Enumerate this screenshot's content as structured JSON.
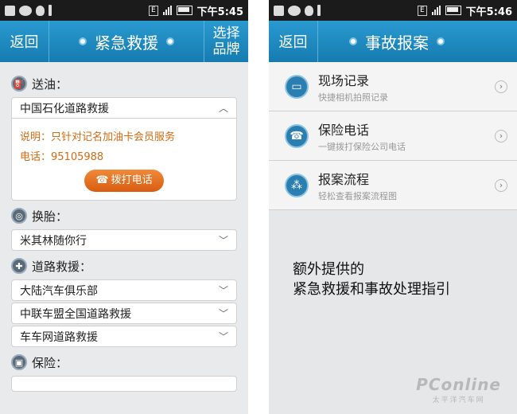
{
  "status_bar": {
    "left_time": "下午5:45",
    "right_time": "下午5:46",
    "network_badge": "E"
  },
  "left": {
    "nav": {
      "back": "返回",
      "title": "紧急救援",
      "right_line1": "选择",
      "right_line2": "品牌"
    },
    "fuel": {
      "label": "送油：",
      "icon": "fuel-icon",
      "provider": "中国石化道路救援",
      "note": "说明：只针对记名加油卡会员服务",
      "phone": "电话：95105988",
      "call_button": "拨打电话"
    },
    "tire": {
      "label": "换胎：",
      "icon": "tire-icon",
      "provider": "米其林随你行"
    },
    "road": {
      "label": "道路救援：",
      "icon": "road-rescue-icon",
      "providers": [
        "大陆汽车俱乐部",
        "中联车盟全国道路救援",
        "车车网道路救援"
      ]
    },
    "insurance": {
      "label": "保险：",
      "icon": "lock-icon"
    }
  },
  "right": {
    "nav": {
      "back": "返回",
      "title": "事故报案"
    },
    "items": [
      {
        "title": "现场记录",
        "sub": "快捷相机拍照记录",
        "icon": "camera-icon"
      },
      {
        "title": "保险电话",
        "sub": "一键拨打保险公司电话",
        "icon": "telephone-icon"
      },
      {
        "title": "报案流程",
        "sub": "轻松查看报案流程图",
        "icon": "flow-icon"
      }
    ],
    "caption_line1": "额外提供的",
    "caption_line2": "紧急救援和事故处理指引"
  },
  "watermark": {
    "logo": "PConline",
    "sub": "太平洋汽车网"
  },
  "colors": {
    "nav_blue": "#1d8bc2",
    "orange_text": "#d46a12",
    "call_button": "#e06818"
  }
}
